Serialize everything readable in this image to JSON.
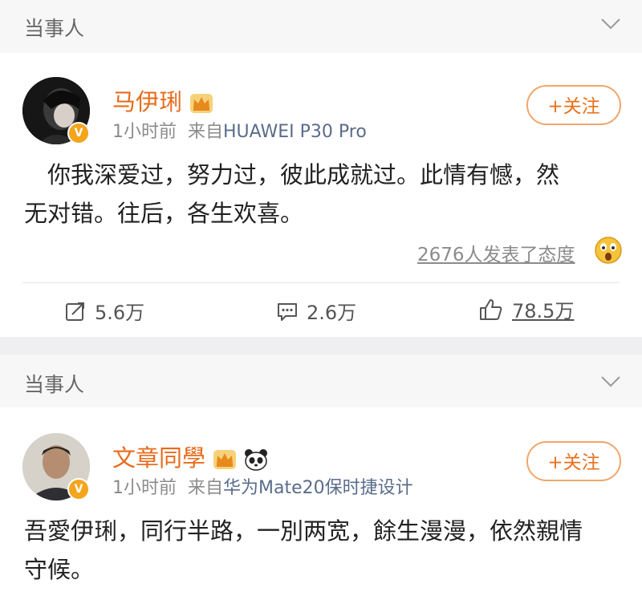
{
  "post1": {
    "section_title": "当事人",
    "author": "马伊琍",
    "time": "1小时前",
    "source_prefix": "来自",
    "source": "HUAWEI P30 Pro",
    "follow_label": "+关注",
    "text_line1": "　你我深爱过，努力过，彼此成就过。此情有憾，然",
    "text_line2": "无对错。往后，各生欢喜。",
    "attitude": "2676人发表了态度",
    "repost": "5.6万",
    "comment": "2.6万",
    "like": "78.5万"
  },
  "post2": {
    "section_title": "当事人",
    "author": "文章同學",
    "time": "1小时前",
    "source_prefix": "来自",
    "source": "华为Mate20保时捷设计",
    "follow_label": "+关注",
    "text_line1": "吾愛伊琍，同行半路，一別两宽，餘生漫漫，依然親情",
    "text_line2": "守候。"
  },
  "colors": {
    "accent": "#e86b1c",
    "badge": "#f4a51c",
    "source": "#5a6c8a"
  }
}
